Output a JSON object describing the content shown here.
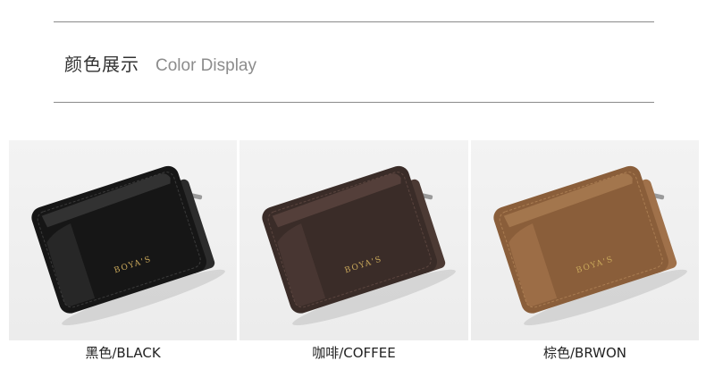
{
  "section": {
    "title_cn": "颜色展示",
    "title_en": "Color Display"
  },
  "products": [
    {
      "label": "黑色/BLACK",
      "brand": "BOYA'S",
      "color": "#161616",
      "edge": "#2c2c2c",
      "highlight": "#4a4a4a"
    },
    {
      "label": "咖啡/COFFEE",
      "brand": "BOYA'S",
      "color": "#3a2c28",
      "edge": "#4c3a34",
      "highlight": "#6a5048"
    },
    {
      "label": "棕色/BRWON",
      "brand": "BOYA'S",
      "color": "#8a5e3a",
      "edge": "#a0714a",
      "highlight": "#b88a5c"
    }
  ]
}
